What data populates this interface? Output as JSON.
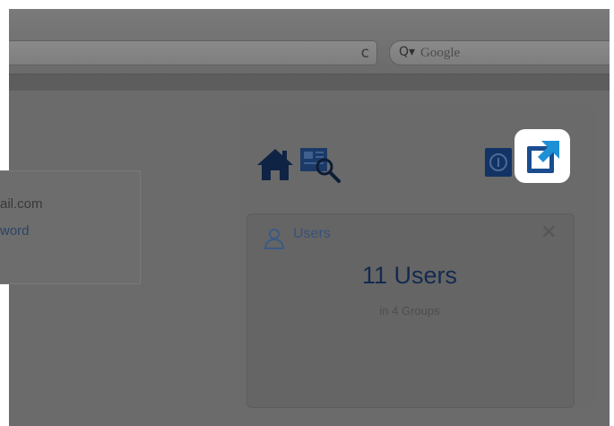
{
  "browser": {
    "search_placeholder": "Google",
    "reload_glyph": "c"
  },
  "login_card": {
    "email_fragment": "ail.com",
    "password_fragment": "word"
  },
  "dashboard": {
    "toolbar_icons": [
      "home-icon",
      "search-users-icon",
      "info-icon",
      "export-icon"
    ],
    "widget": {
      "title": "Users",
      "count_number": "11",
      "count_label": "Users",
      "subtitle": "in 4 Groups",
      "close_glyph": "✕"
    }
  },
  "colors": {
    "accent_blue": "#1f4d8c",
    "highlight": "#ffffff",
    "dim_overlay": "#6b6b6b"
  }
}
